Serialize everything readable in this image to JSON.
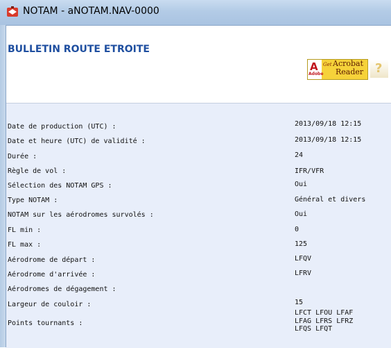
{
  "window": {
    "title": "NOTAM - aNOTAM.NAV-0000",
    "icon": "notam-app-icon"
  },
  "bulletin": {
    "title": "BULLETIN ROUTE ETROITE"
  },
  "acrobat": {
    "brand": "Adobe",
    "get": "Get",
    "line1": "Acrobat",
    "line2": "Reader",
    "logo_letter": "A"
  },
  "help": {
    "symbol": "?"
  },
  "fields": [
    {
      "label": "Date de production (UTC) :",
      "value": "2013/09/18 12:15"
    },
    {
      "label": "Date et heure (UTC) de validité :",
      "value": "2013/09/18 12:15"
    },
    {
      "label": "Durée :",
      "value": "24"
    },
    {
      "label": "Règle de vol :",
      "value": "IFR/VFR"
    },
    {
      "label": "Sélection des NOTAM GPS :",
      "value": "Oui"
    },
    {
      "label": "Type NOTAM :",
      "value": "Général et divers"
    },
    {
      "label": "NOTAM sur les aérodromes survolés :",
      "value": "Oui"
    },
    {
      "label": "FL min :",
      "value": "0"
    },
    {
      "label": "FL max :",
      "value": "125"
    },
    {
      "label": "Aérodrome de départ :",
      "value": "LFQV"
    },
    {
      "label": "Aérodrome d'arrivée :",
      "value": "LFRV"
    },
    {
      "label": "Aérodromes de dégagement :",
      "value": ""
    },
    {
      "label": "Largeur de couloir :",
      "value": "15"
    }
  ],
  "waypoints": {
    "label": "Points tournants :",
    "lines": [
      "LFCT LFOU LFAF",
      "LFAG LFRS LFRZ",
      "LFQS LFQT"
    ]
  },
  "colors": {
    "title_blue": "#1f4fa0",
    "panel_bg": "#e8eefa",
    "titlebar": "#b3cbe6"
  }
}
